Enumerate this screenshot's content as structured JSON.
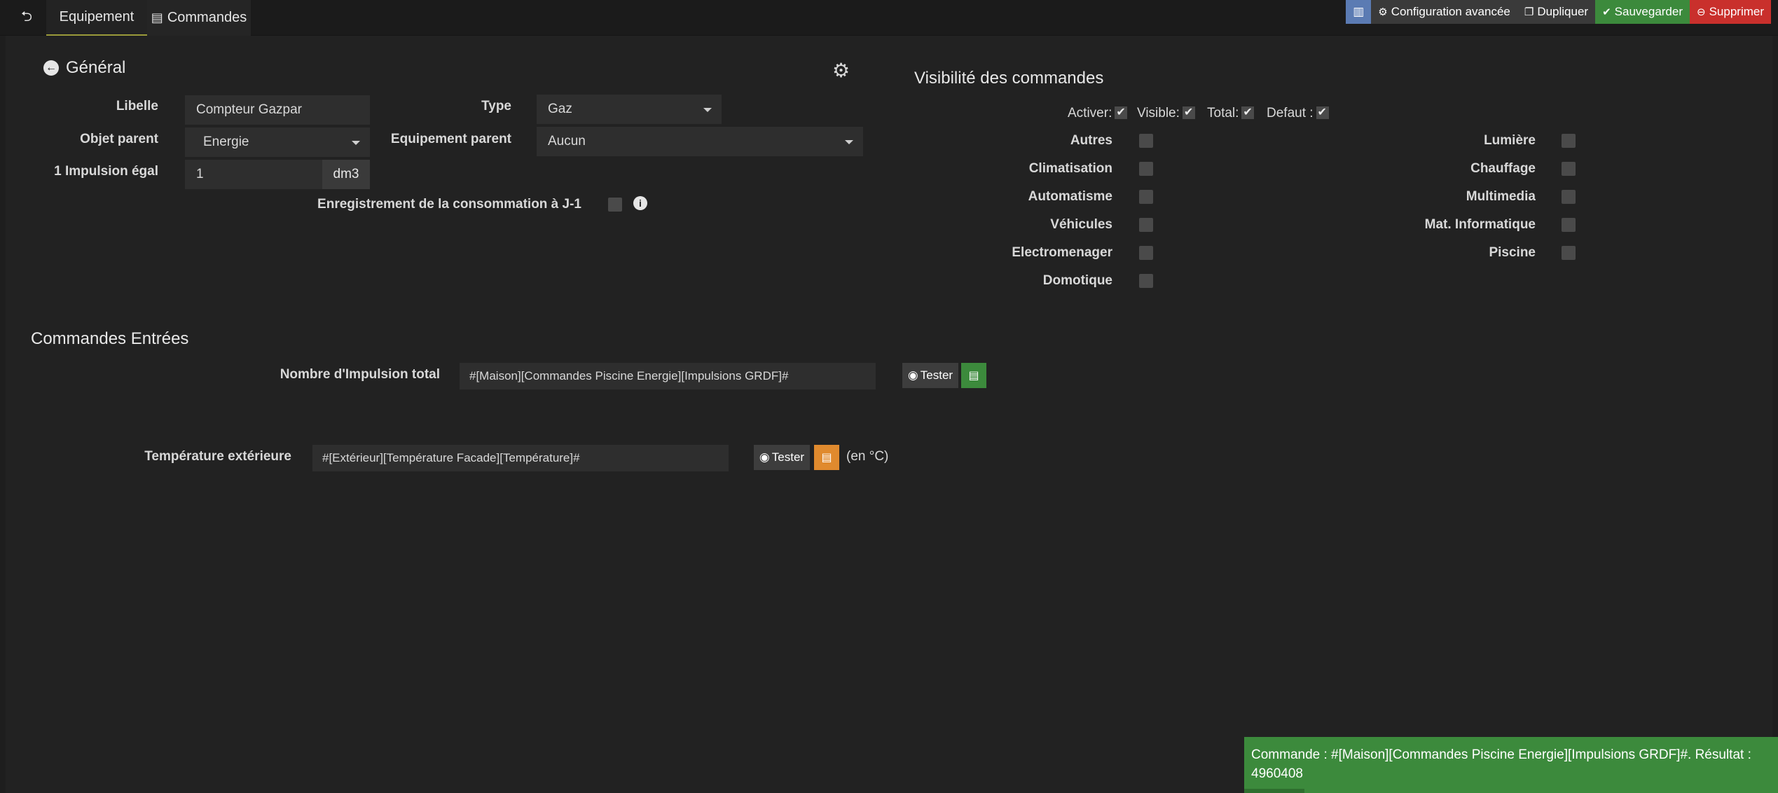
{
  "tabs": {
    "back_icon": "arrow-left-circle-icon",
    "equipement": "Equipement",
    "commandes": "Commandes"
  },
  "actions": {
    "config": "Configuration avancée",
    "dupliquer": "Dupliquer",
    "sauvegarder": "Sauvegarder",
    "supprimer": "Supprimer"
  },
  "general": {
    "title": "Général",
    "libelle_label": "Libelle",
    "libelle_value": "Compteur Gazpar",
    "type_label": "Type",
    "type_value": "Gaz",
    "objet_label": "Objet parent",
    "objet_value": "Energie",
    "equip_parent_label": "Equipement parent",
    "equip_parent_value": "Aucun",
    "impulsion_label": "1 Impulsion égal",
    "impulsion_value": "1",
    "impulsion_unit": "dm3",
    "enreg_label": "Enregistrement de la consommation à J-1"
  },
  "visibilite": {
    "title": "Visibilité des commandes",
    "activer": "Activer:",
    "visible": "Visible:",
    "total": "Total:",
    "defaut": "Defaut :",
    "left": [
      "Autres",
      "Climatisation",
      "Automatisme",
      "Véhicules",
      "Electromenager",
      "Domotique"
    ],
    "right": [
      "Lumière",
      "Chauffage",
      "Multimedia",
      "Mat. Informatique",
      "Piscine"
    ]
  },
  "commandes": {
    "title": "Commandes Entrées",
    "impulsion_label": "Nombre d'Impulsion total",
    "impulsion_value": "#[Maison][Commandes Piscine Energie][Impulsions GRDF]#",
    "temp_label": "Température extérieure",
    "temp_value": "#[Extérieur][Température Facade][Température]#",
    "tester": "Tester",
    "unit": "(en °C)"
  },
  "toast": {
    "line1": "Commande : #[Maison][Commandes Piscine Energie][Impulsions GRDF]#. Résultat :",
    "line2": "4960408"
  },
  "colors": {
    "accent_blue": "#5b7bb3",
    "success_green": "#3c8a3c",
    "danger_red": "#c9302c",
    "warning_orange": "#e08a2e"
  }
}
